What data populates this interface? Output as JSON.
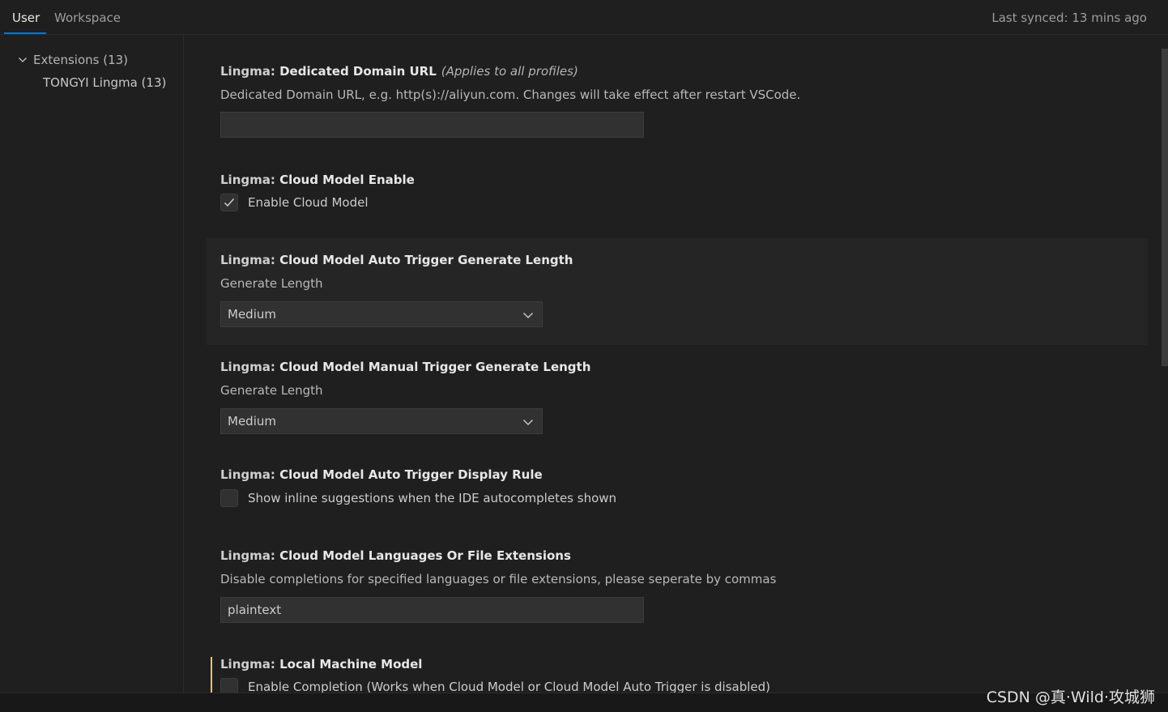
{
  "header": {
    "tabs": [
      {
        "label": "User",
        "active": true
      },
      {
        "label": "Workspace",
        "active": false
      }
    ],
    "sync_status": "Last synced: 13 mins ago"
  },
  "toc": {
    "items": [
      {
        "label": "Extensions (13)",
        "expanded": true
      },
      {
        "label": "TONGYI Lingma (13)"
      }
    ]
  },
  "settings": {
    "dedicated_domain": {
      "category": "Lingma: ",
      "title": "Dedicated Domain URL",
      "scope": "(Applies to all profiles)",
      "description": "Dedicated Domain URL, e.g. http(s)://aliyun.com. Changes will take effect after restart VSCode.",
      "value": ""
    },
    "cloud_model_enable": {
      "category": "Lingma: ",
      "title": "Cloud Model Enable",
      "checkbox_label": "Enable Cloud Model",
      "checked": true
    },
    "auto_trigger_length": {
      "category": "Lingma: ",
      "title": "Cloud Model Auto Trigger Generate Length",
      "description": "Generate Length",
      "selected": "Medium"
    },
    "manual_trigger_length": {
      "category": "Lingma: ",
      "title": "Cloud Model Manual Trigger Generate Length",
      "description": "Generate Length",
      "selected": "Medium"
    },
    "display_rule": {
      "category": "Lingma: ",
      "title": "Cloud Model Auto Trigger Display Rule",
      "checkbox_label": "Show inline suggestions when the IDE autocompletes shown",
      "checked": false
    },
    "languages": {
      "category": "Lingma: ",
      "title": "Cloud Model Languages Or File Extensions",
      "description": "Disable completions for specified languages or file extensions, please seperate by commas",
      "value": "plaintext"
    },
    "local_model": {
      "category": "Lingma: ",
      "title": "Local Machine Model",
      "checkbox_label": "Enable Completion (Works when Cloud Model or Cloud Model Auto Trigger is disabled)",
      "checked": false
    }
  },
  "watermark": "CSDN @真·Wild·攻城狮",
  "colors": {
    "background": "#1f1f1f",
    "accent": "#0078d4",
    "modified_indicator": "#e2c08d",
    "input_background": "#313131"
  }
}
